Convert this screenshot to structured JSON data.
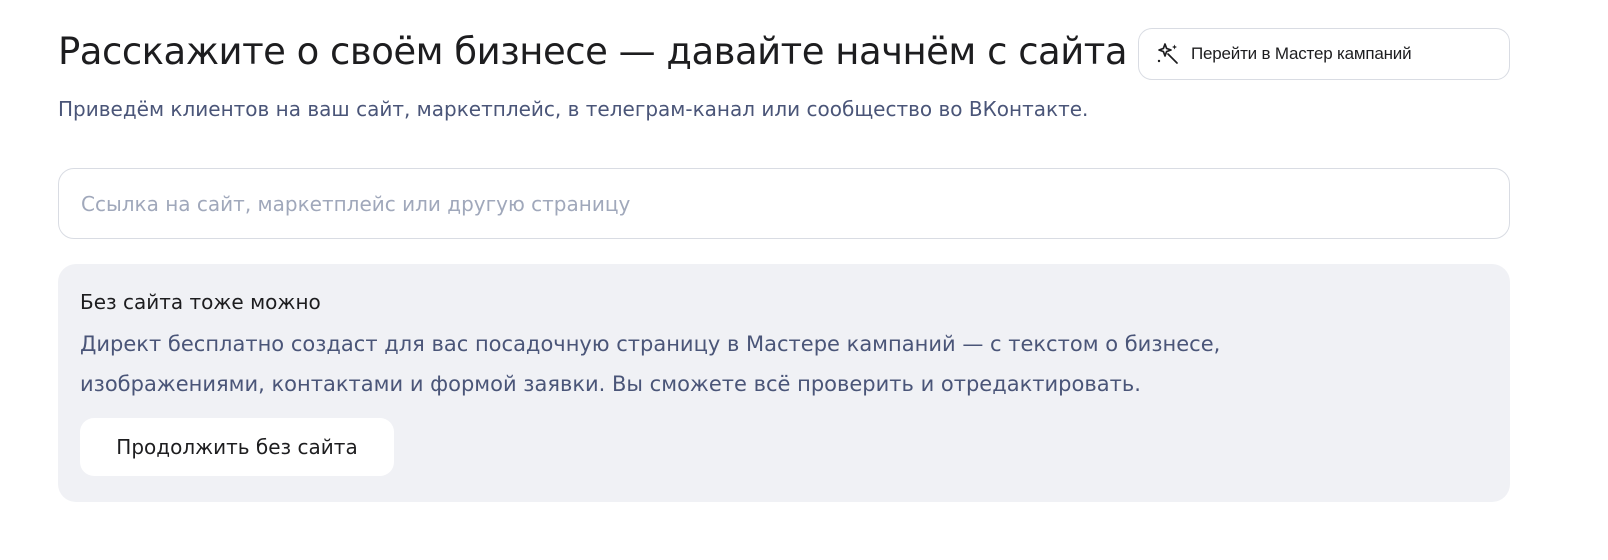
{
  "header": {
    "title": "Расскажите о своём бизнесе — давайте начнём с сайта",
    "subtitle": "Приведём клиентов на ваш сайт, маркетплейс, в телеграм-канал или сообщество во ВКонтакте."
  },
  "master_button": {
    "label": "Перейти в Мастер кампаний",
    "icon": "magic-wand-sparkles-icon"
  },
  "url_input": {
    "value": "",
    "placeholder": "Ссылка на сайт, маркетплейс или другую страницу"
  },
  "no_site_panel": {
    "title": "Без сайта тоже можно",
    "text_line1": "Директ бесплатно создаст для вас посадочную страницу в Мастере кампаний — с текстом о бизнесе,",
    "text_line2": "изображениями, контактами и формой заявки. Вы сможете всё проверить и отредактировать.",
    "button_label": "Продолжить без сайта"
  },
  "colors": {
    "text_primary": "#1d1d1f",
    "text_secondary": "#4a5578",
    "placeholder": "#a0a8bb",
    "panel_bg": "#f0f1f5",
    "border": "#d9dce3"
  }
}
